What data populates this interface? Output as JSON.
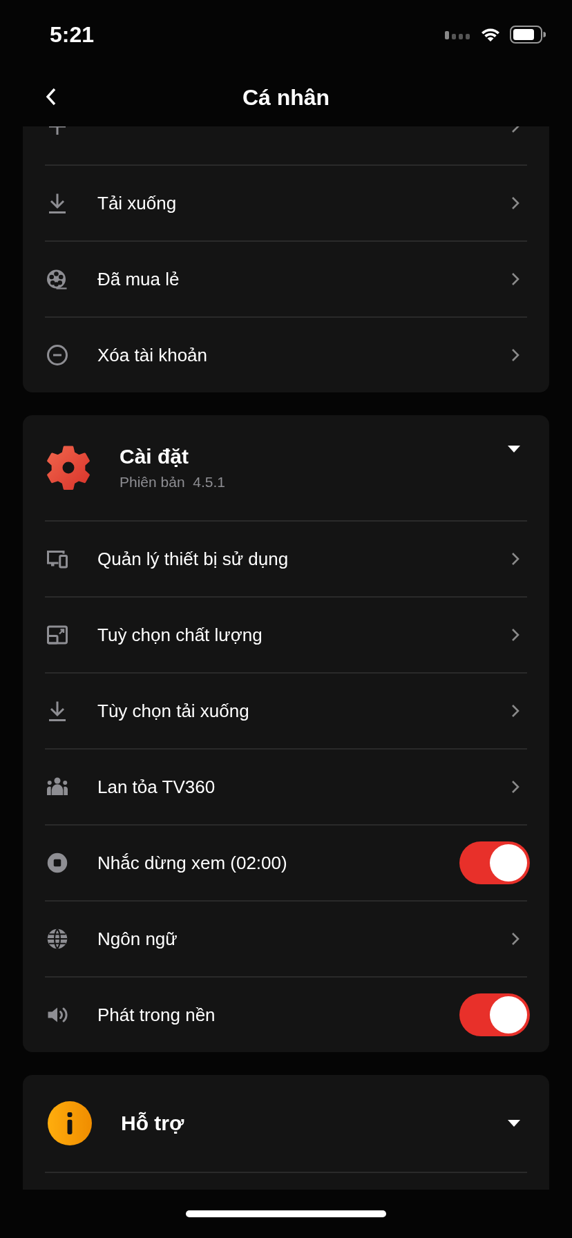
{
  "status_bar": {
    "time": "5:21"
  },
  "nav": {
    "title": "Cá nhân"
  },
  "sections": [
    {
      "items": [
        {
          "kind": "link"
        },
        {
          "label": "Tải xuống",
          "kind": "link"
        },
        {
          "label": "Đã mua lẻ",
          "kind": "link"
        },
        {
          "label": "Xóa tài khoản",
          "kind": "link"
        }
      ]
    },
    {
      "title": "Cài đặt",
      "subtitle": "Phiên bản  4.5.1",
      "items": [
        {
          "label": "Quản lý thiết bị sử dụng",
          "kind": "link"
        },
        {
          "label": "Tuỳ chọn chất lượng",
          "kind": "link"
        },
        {
          "label": "Tùy chọn tải xuống",
          "kind": "link"
        },
        {
          "label": "Lan tỏa TV360",
          "kind": "link"
        },
        {
          "label": "Nhắc dừng xem (02:00)",
          "kind": "toggle",
          "on": true
        },
        {
          "label": "Ngôn ngữ",
          "kind": "link"
        },
        {
          "label": "Phát trong nền",
          "kind": "toggle",
          "on": true
        }
      ]
    },
    {
      "title": "Hỗ trợ"
    }
  ]
}
